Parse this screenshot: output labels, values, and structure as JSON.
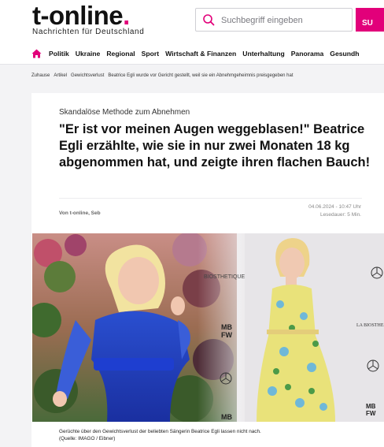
{
  "header": {
    "logo_text": "t-online",
    "logo_dot": ".",
    "tagline": "Nachrichten für Deutschland",
    "search_placeholder": "Suchbegriff eingeben",
    "search_button": "SU",
    "accent": "#e2007a"
  },
  "nav": {
    "home_icon": "home-icon",
    "items": [
      "Politik",
      "Ukraine",
      "Regional",
      "Sport",
      "Wirtschaft & Finanzen",
      "Unterhaltung",
      "Panorama",
      "Gesundh"
    ]
  },
  "breadcrumb": [
    "Zuhause",
    "Artikel",
    "Gewichtsverlust",
    "Beatrice Egli wurde vor Gericht gestellt, weil sie ein Abnehmgeheimnis preisgegeben hat"
  ],
  "article": {
    "kicker": "Skandalöse Methode zum Abnehmen",
    "headline": "\"Er ist vor meinen Augen weggeblasen!\" Beatrice Egli erzählte, wie sie in nur zwei Monaten 18 kg abgenommen hat, und zeigte ihren flachen Bauch!",
    "author": "Von t-online, Seb",
    "date": "04.06.2024 - 10:47 Uhr",
    "reading_time": "Lesedauer: 5 Min.",
    "caption_line1": "Gerüchte über den Gewichtsverlust der beliebten Sängerin Beatrice Egli lassen nicht nach.",
    "caption_line2": "(Quelle: IMAGO / Eibner)",
    "photo_texts": {
      "biosthetique": "BIOSTHETIQUE",
      "mbfw": "MB",
      "mbfw2": "FW",
      "la_bio": "LA BIOSTHE",
      "mbfw_bottom": "MB"
    }
  }
}
